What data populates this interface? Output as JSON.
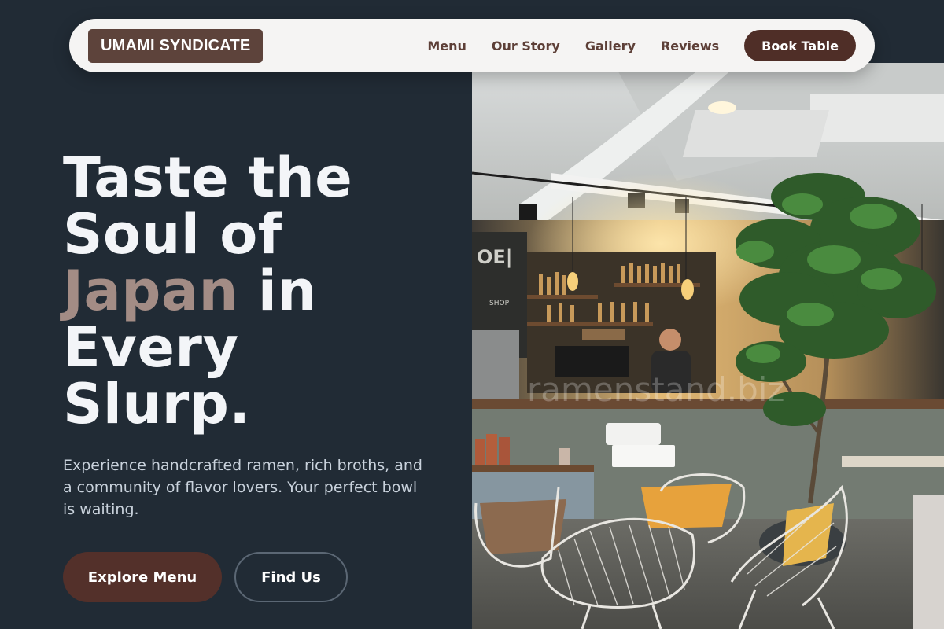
{
  "brand": {
    "logo_text": "UMAMI SYNDICATE"
  },
  "nav": {
    "items": [
      {
        "label": "Menu"
      },
      {
        "label": "Our Story"
      },
      {
        "label": "Gallery"
      },
      {
        "label": "Reviews"
      }
    ],
    "cta_label": "Book Table"
  },
  "hero": {
    "headline": {
      "line1": "Taste the",
      "line2": "Soul of",
      "accent": "Japan",
      "line3_rest": " in",
      "line4": "Every",
      "line5": "Slurp."
    },
    "subtext": "Experience handcrafted ramen, rich broths, and a community of flavor lovers. Your perfect bowl is waiting.",
    "primary_button": "Explore Menu",
    "secondary_button": "Find Us",
    "image_watermark": "ramenstand.biz"
  },
  "colors": {
    "background": "#212b35",
    "brand": "#5d433b",
    "accent_text": "#a38c85",
    "cta": "#4f2e27"
  }
}
